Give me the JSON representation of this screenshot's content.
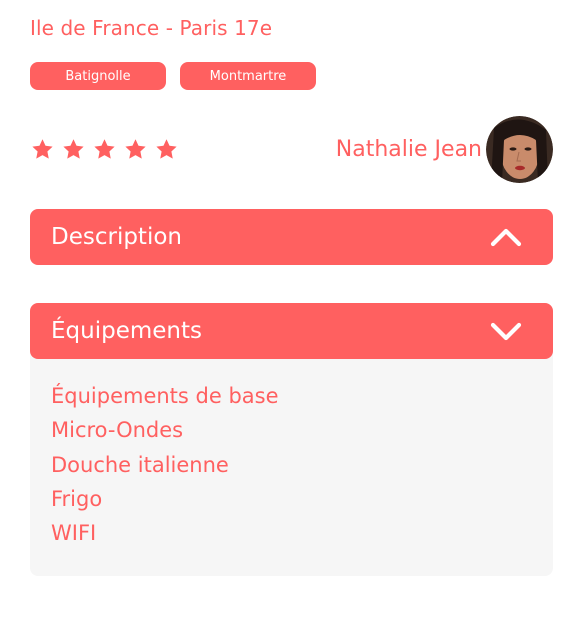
{
  "location": "Ile de France - Paris 17e",
  "tags": [
    "Batignolle",
    "Montmartre"
  ],
  "rating": {
    "value": 5,
    "max": 5,
    "filled_color": "#ff6060"
  },
  "host": {
    "name": "Nathalie Jean"
  },
  "description": {
    "title": "Description",
    "expanded": false,
    "icon": "chevron-up-icon"
  },
  "equipments": {
    "title": "Équipements",
    "expanded": true,
    "icon": "chevron-down-icon",
    "items": [
      "Équipements de base",
      "Micro-Ondes",
      "Douche italienne",
      "Frigo",
      "WIFI"
    ]
  },
  "colors": {
    "accent": "#ff6060",
    "panel_background": "#f6f6f6",
    "text_on_accent": "#ffffff"
  }
}
